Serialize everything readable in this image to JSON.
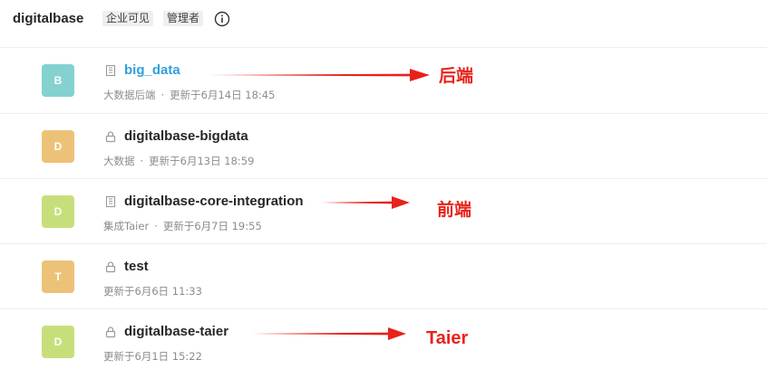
{
  "group": {
    "name": "digitalbase",
    "visibility_tag": "企业可见",
    "role_tag": "管理者",
    "info_icon": "info-circle-icon"
  },
  "repos": [
    {
      "initial": "B",
      "avatar_color": "#83d2d0",
      "type_icon": "building-icon",
      "name": "big_data",
      "name_color": "#2fa0dd",
      "description": "大数据后端",
      "updated": "更新于6月14日 18:45"
    },
    {
      "initial": "D",
      "avatar_color": "#ecc278",
      "type_icon": "lock-icon",
      "name": "digitalbase-bigdata",
      "description": "大数据",
      "updated": "更新于6月13日 18:59"
    },
    {
      "initial": "D",
      "avatar_color": "#c7df7a",
      "type_icon": "building-icon",
      "name": "digitalbase-core-integration",
      "description": "集成Taier",
      "updated": "更新于6月7日 19:55"
    },
    {
      "initial": "T",
      "avatar_color": "#ecc278",
      "type_icon": "lock-icon",
      "name": "test",
      "description": "",
      "updated": "更新于6月6日 11:33"
    },
    {
      "initial": "D",
      "avatar_color": "#c7df7a",
      "type_icon": "lock-icon",
      "name": "digitalbase-taier",
      "description": "",
      "updated": "更新于6月1日 15:22"
    }
  ],
  "annotations": {
    "backend": "后端",
    "frontend": "前端",
    "taier": "Taier",
    "color": "#e8221b"
  }
}
